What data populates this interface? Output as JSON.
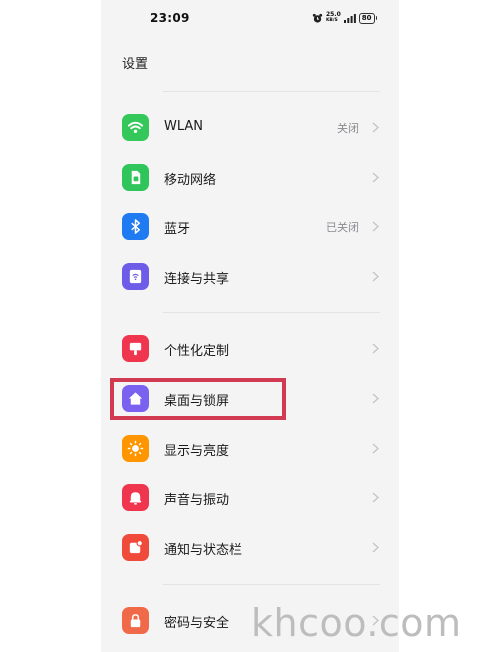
{
  "status_bar": {
    "time": "23:09",
    "net_speed_value": "25.0",
    "net_speed_unit": "KB/S",
    "battery": "80"
  },
  "header": {
    "title": "设置"
  },
  "sections": [
    {
      "items": [
        {
          "label": "WLAN",
          "status": "关闭",
          "icon": "wifi-icon",
          "icon_color": "#34c759"
        },
        {
          "label": "移动网络",
          "status": "",
          "icon": "sim-card-icon",
          "icon_color": "#2fc55a"
        },
        {
          "label": "蓝牙",
          "status": "已关闭",
          "icon": "bluetooth-icon",
          "icon_color": "#1f7bf2"
        },
        {
          "label": "连接与共享",
          "status": "",
          "icon": "connection-sharing-icon",
          "icon_color": "#6c5ce7"
        }
      ]
    },
    {
      "items": [
        {
          "label": "个性化定制",
          "status": "",
          "icon": "personalization-icon",
          "icon_color": "#f0364f"
        },
        {
          "label": "桌面与锁屏",
          "status": "",
          "icon": "home-icon",
          "icon_color": "#7b61f0"
        },
        {
          "label": "显示与亮度",
          "status": "",
          "icon": "sun-icon",
          "icon_color": "#ff9500"
        },
        {
          "label": "声音与振动",
          "status": "",
          "icon": "bell-icon",
          "icon_color": "#f0364f"
        },
        {
          "label": "通知与状态栏",
          "status": "",
          "icon": "notification-icon",
          "icon_color": "#f04a3a"
        }
      ]
    },
    {
      "items": [
        {
          "label": "密码与安全",
          "status": "",
          "icon": "lock-icon",
          "icon_color": "#f06a4a"
        }
      ]
    }
  ],
  "watermark": "khcoo.com",
  "highlight_color": "#d23a52"
}
